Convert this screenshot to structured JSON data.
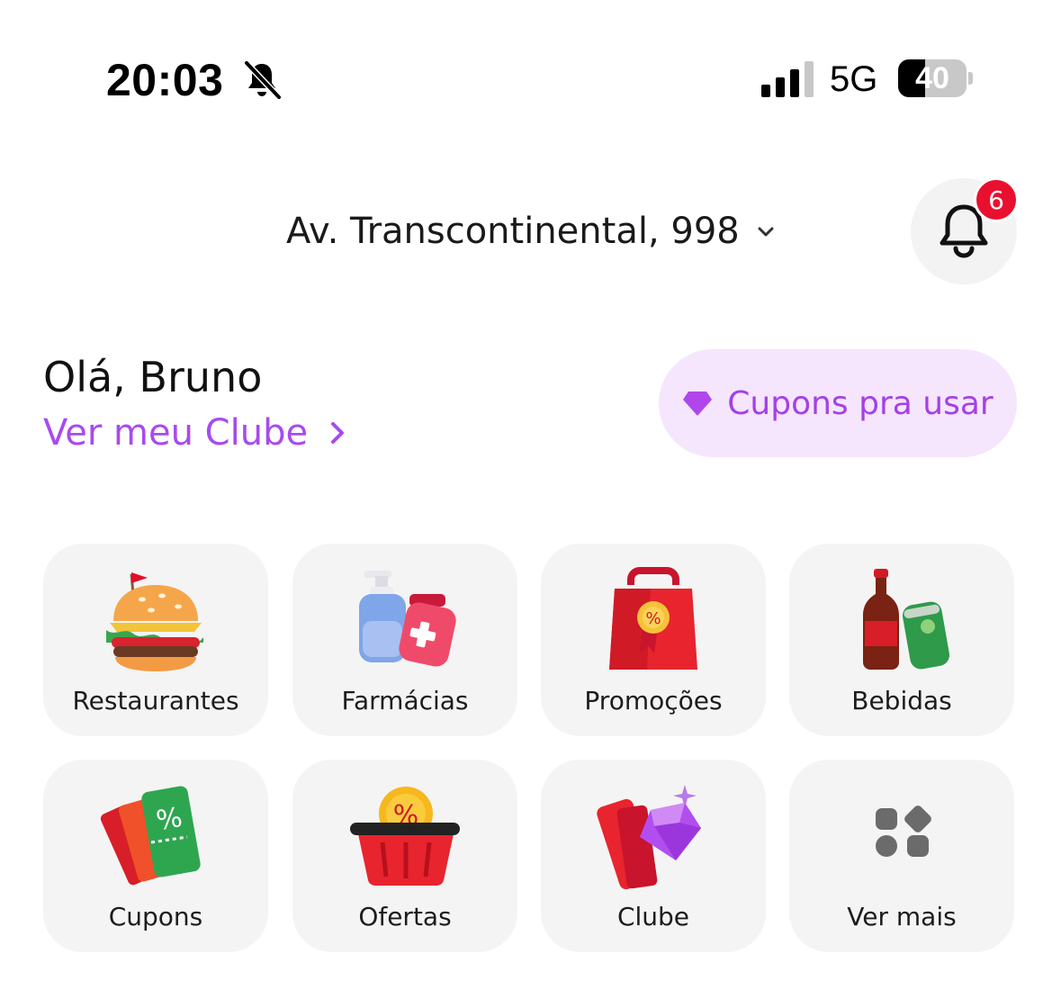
{
  "status_bar": {
    "time": "20:03",
    "network": "5G",
    "battery_level": "40",
    "battery_fraction": 0.4
  },
  "header": {
    "address": "Av. Transcontinental, 998",
    "notification_count": "6"
  },
  "greeting": {
    "title": "Olá, Bruno",
    "club_link": "Ver meu Clube",
    "coupons_button": "Cupons pra usar"
  },
  "categories": [
    {
      "label": "Restaurantes",
      "icon": "burger-icon"
    },
    {
      "label": "Farmácias",
      "icon": "pharmacy-icon"
    },
    {
      "label": "Promoções",
      "icon": "promo-bag-icon"
    },
    {
      "label": "Bebidas",
      "icon": "drinks-icon"
    },
    {
      "label": "Cupons",
      "icon": "coupon-tickets-icon"
    },
    {
      "label": "Ofertas",
      "icon": "offers-basket-icon"
    },
    {
      "label": "Clube",
      "icon": "club-diamond-icon"
    },
    {
      "label": "Ver mais",
      "icon": "more-grid-icon"
    }
  ],
  "colors": {
    "accent_purple": "#a84af0",
    "pill_background": "#f5e6fd",
    "badge_red": "#e8102e",
    "tile_background": "#f4f4f4"
  }
}
